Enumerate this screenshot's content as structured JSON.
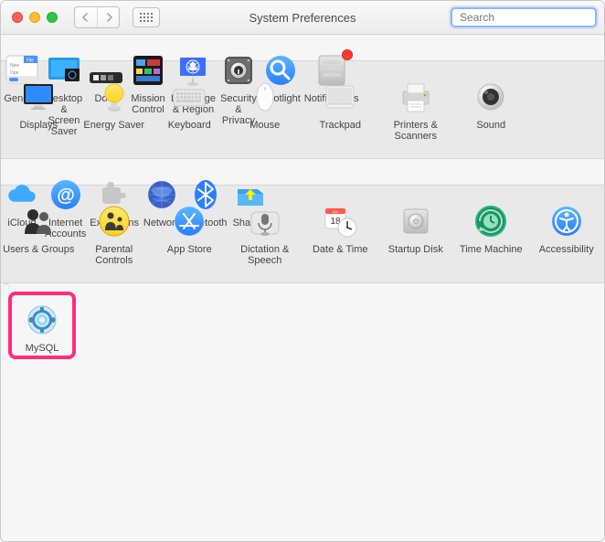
{
  "window": {
    "title": "System Preferences"
  },
  "search": {
    "placeholder": "Search",
    "value": ""
  },
  "rows": [
    {
      "class": "light",
      "items": [
        {
          "key": "general",
          "label": "General",
          "icon": "general-icon"
        },
        {
          "key": "desktop",
          "label": "Desktop & Screen Saver",
          "icon": "desktop-icon"
        },
        {
          "key": "dock",
          "label": "Dock",
          "icon": "dock-icon"
        },
        {
          "key": "mission",
          "label": "Mission Control",
          "icon": "mission-control-icon"
        },
        {
          "key": "language",
          "label": "Language & Region",
          "icon": "language-region-icon"
        },
        {
          "key": "security",
          "label": "Security & Privacy",
          "icon": "security-icon"
        },
        {
          "key": "spotlight",
          "label": "Spotlight",
          "icon": "spotlight-icon"
        },
        {
          "key": "notifications",
          "label": "Notifications",
          "icon": "notifications-icon",
          "badge": true
        }
      ]
    },
    {
      "class": "dark",
      "items": [
        {
          "key": "displays",
          "label": "Displays",
          "icon": "displays-icon"
        },
        {
          "key": "energy",
          "label": "Energy Saver",
          "icon": "energy-icon"
        },
        {
          "key": "keyboard",
          "label": "Keyboard",
          "icon": "keyboard-icon"
        },
        {
          "key": "mouse",
          "label": "Mouse",
          "icon": "mouse-icon"
        },
        {
          "key": "trackpad",
          "label": "Trackpad",
          "icon": "trackpad-icon"
        },
        {
          "key": "printers",
          "label": "Printers & Scanners",
          "icon": "printers-icon"
        },
        {
          "key": "sound",
          "label": "Sound",
          "icon": "sound-icon"
        }
      ]
    },
    {
      "class": "light",
      "items": [
        {
          "key": "icloud",
          "label": "iCloud",
          "icon": "icloud-icon"
        },
        {
          "key": "internet",
          "label": "Internet Accounts",
          "icon": "internet-accounts-icon"
        },
        {
          "key": "extensions",
          "label": "Extensions",
          "icon": "extensions-icon"
        },
        {
          "key": "network",
          "label": "Network",
          "icon": "network-icon"
        },
        {
          "key": "bluetooth",
          "label": "Bluetooth",
          "icon": "bluetooth-icon"
        },
        {
          "key": "sharing",
          "label": "Sharing",
          "icon": "sharing-icon"
        }
      ]
    },
    {
      "class": "dark",
      "items": [
        {
          "key": "users",
          "label": "Users & Groups",
          "icon": "users-icon"
        },
        {
          "key": "parental",
          "label": "Parental Controls",
          "icon": "parental-icon"
        },
        {
          "key": "appstore",
          "label": "App Store",
          "icon": "appstore-icon"
        },
        {
          "key": "dictation",
          "label": "Dictation & Speech",
          "icon": "dictation-icon"
        },
        {
          "key": "datetime",
          "label": "Date & Time",
          "icon": "datetime-icon"
        },
        {
          "key": "startup",
          "label": "Startup Disk",
          "icon": "startup-icon"
        },
        {
          "key": "timemachine",
          "label": "Time Machine",
          "icon": "timemachine-icon"
        },
        {
          "key": "accessibility",
          "label": "Accessibility",
          "icon": "accessibility-icon"
        }
      ]
    },
    {
      "class": "light last",
      "items": [
        {
          "key": "mysql",
          "label": "MySQL",
          "icon": "mysql-icon",
          "highlight": true
        }
      ]
    }
  ]
}
